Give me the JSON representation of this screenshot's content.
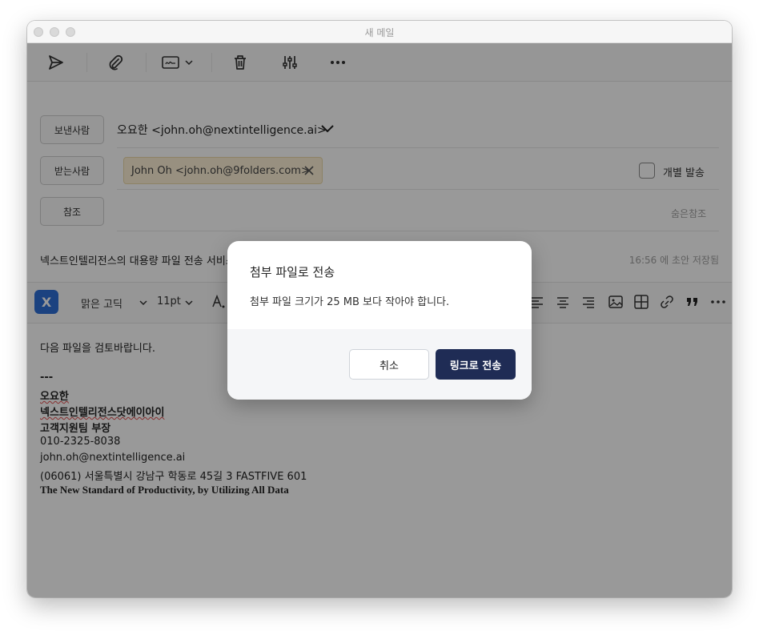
{
  "window": {
    "title": "새 메일"
  },
  "toolbar": {
    "send_icon": "send-icon",
    "attach_icon": "paperclip-icon",
    "signature_icon": "signature-icon",
    "delete_icon": "trash-icon",
    "settings_icon": "sliders-icon",
    "more_icon": "more-icon"
  },
  "compose": {
    "from_button": "보낸사람",
    "from_value": "오요한 <john.oh@nextintelligence.ai>",
    "to_button": "받는사람",
    "to_chip": "John Oh <john.oh@9folders.com>",
    "individual_send_label": "개별 발송",
    "cc_button": "참조",
    "bcc_label": "숨은참조",
    "subject": "넥스트인텔리전스의 대용량 파일 전송 서비스 이용하기",
    "saved_status": "16:56 에 초안 저장됨"
  },
  "format_bar": {
    "font_family": "맑은 고딕",
    "font_size": "11pt",
    "logo_letter": "X"
  },
  "body": {
    "greeting": "다음 파일을 검토바랍니다.",
    "separator": "---",
    "sig_name": "오요한",
    "sig_company": "넥스트인텔리전스닷에이아이",
    "sig_title": "고객지원팀 부장",
    "sig_phone": "010-2325-8038",
    "sig_email": "john.oh@nextintelligence.ai",
    "sig_address": "(06061) 서울특별시 강남구 학동로 45길 3 FASTFIVE 601",
    "sig_slogan": "The New Standard of Productivity, by Utilizing All Data"
  },
  "modal": {
    "title": "첨부 파일로 전송",
    "message": "첨부 파일 크기가 25 MB 보다 작아야 합니다.",
    "cancel_label": "취소",
    "confirm_label": "링크로 전송"
  },
  "colors": {
    "primary_button": "#1f2c55",
    "chip_background": "#fdf1d6",
    "logo_blue": "#2e6fd6"
  }
}
